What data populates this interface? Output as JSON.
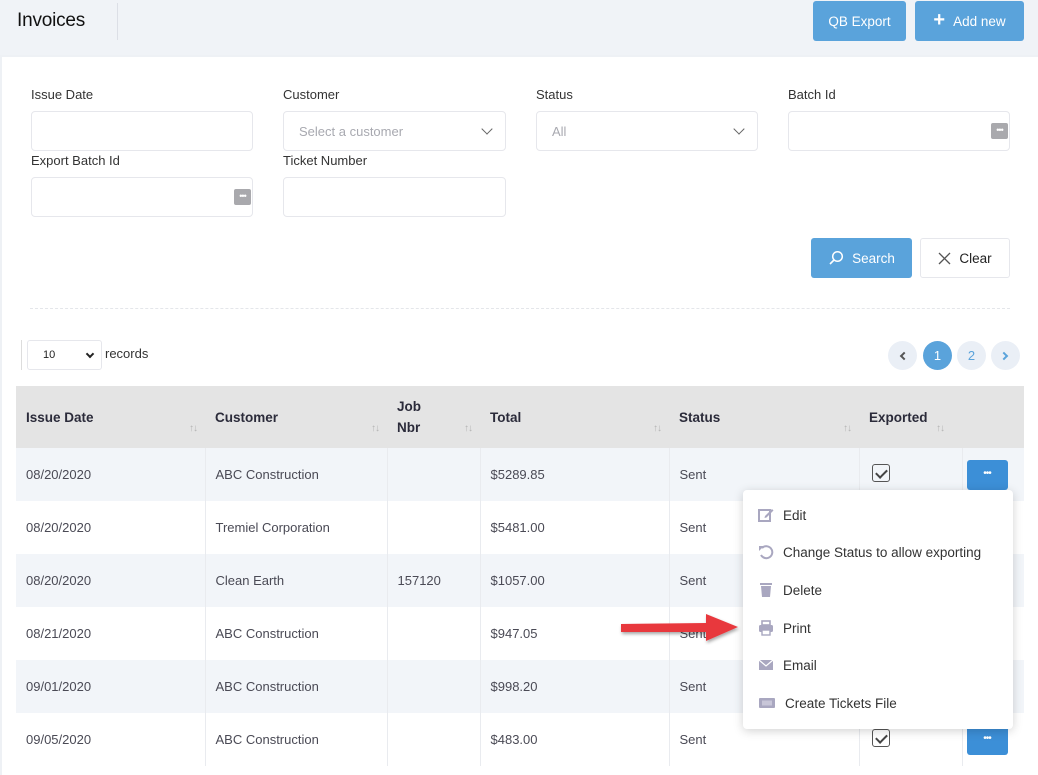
{
  "header": {
    "title": "Invoices",
    "qb_export_label": "QB Export",
    "add_new_label": "Add new"
  },
  "filters": {
    "issue_date": {
      "label": "Issue Date",
      "value": ""
    },
    "customer": {
      "label": "Customer",
      "placeholder": "Select a customer"
    },
    "status": {
      "label": "Status",
      "value": "All"
    },
    "batch_id": {
      "label": "Batch Id",
      "value": ""
    },
    "export_batch_id": {
      "label": "Export Batch Id",
      "value": ""
    },
    "ticket_number": {
      "label": "Ticket Number",
      "value": ""
    },
    "search_label": "Search",
    "clear_label": "Clear"
  },
  "list_controls": {
    "page_size": "10",
    "records_label": "records",
    "pages": [
      "1",
      "2"
    ],
    "current_page": "1"
  },
  "table": {
    "columns": [
      "Issue Date",
      "Customer",
      "Job Nbr",
      "Total",
      "Status",
      "Exported"
    ],
    "rows": [
      {
        "issue_date": "08/20/2020",
        "customer": "ABC Construction",
        "job_nbr": "",
        "total": "$5289.85",
        "status": "Sent",
        "exported": true
      },
      {
        "issue_date": "08/20/2020",
        "customer": "Tremiel Corporation",
        "job_nbr": "",
        "total": "$5481.00",
        "status": "Sent",
        "exported": true
      },
      {
        "issue_date": "08/20/2020",
        "customer": "Clean Earth",
        "job_nbr": "157120",
        "total": "$1057.00",
        "status": "Sent",
        "exported": true
      },
      {
        "issue_date": "08/21/2020",
        "customer": "ABC Construction",
        "job_nbr": "",
        "total": "$947.05",
        "status": "Sent",
        "exported": true
      },
      {
        "issue_date": "09/01/2020",
        "customer": "ABC Construction",
        "job_nbr": "",
        "total": "$998.20",
        "status": "Sent",
        "exported": true
      },
      {
        "issue_date": "09/05/2020",
        "customer": "ABC Construction",
        "job_nbr": "",
        "total": "$483.00",
        "status": "Sent",
        "exported": true
      }
    ]
  },
  "row_menu": {
    "items": [
      {
        "label": "Edit",
        "icon": "edit-icon"
      },
      {
        "label": "Change Status to allow exporting",
        "icon": "undo-icon"
      },
      {
        "label": "Delete",
        "icon": "trash-icon"
      },
      {
        "label": "Print",
        "icon": "printer-icon"
      },
      {
        "label": "Email",
        "icon": "envelope-icon"
      },
      {
        "label": "Create Tickets File",
        "icon": "ticket-icon"
      }
    ]
  },
  "colors": {
    "primary": "#5aa3db",
    "row_action": "#3c8fd7",
    "annotation_arrow": "#e8383d",
    "menu_icon": "#a9a7c0"
  }
}
